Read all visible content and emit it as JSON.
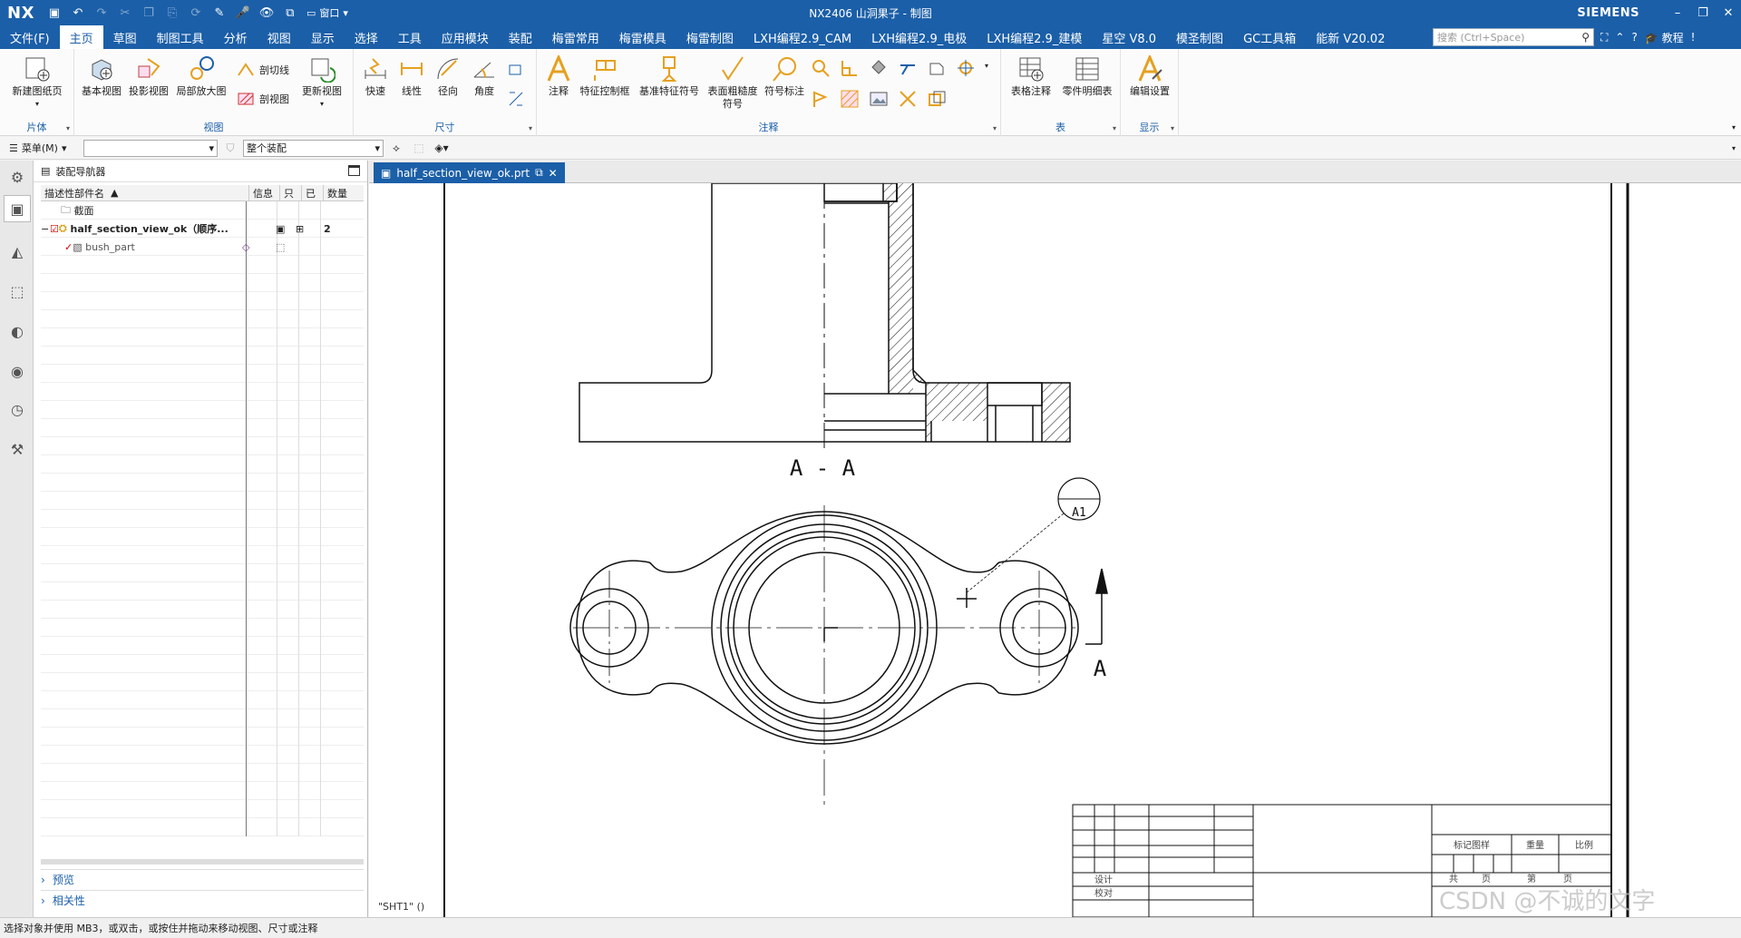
{
  "titlebar": {
    "logo": "NX",
    "window_title": "NX2406 山洞果子 - 制图",
    "brand": "SIEMENS",
    "menu_label": "窗口"
  },
  "menubar": {
    "items": [
      "文件(F)",
      "主页",
      "草图",
      "制图工具",
      "分析",
      "视图",
      "显示",
      "选择",
      "工具",
      "应用模块",
      "装配",
      "梅雷常用",
      "梅雷模具",
      "梅雷制图",
      "LXH编程2.9_CAM",
      "LXH编程2.9_电极",
      "LXH编程2.9_建模",
      "星空 V8.0",
      "模圣制图",
      "GC工具箱",
      "能新 V20.02"
    ],
    "active_index": 1,
    "search_placeholder": "搜索 (Ctrl+Space)",
    "tutorial": "教程"
  },
  "ribbon": {
    "groups": {
      "sheet": "片体",
      "view": "视图",
      "dimension": "尺寸",
      "annotation": "注释",
      "table": "表",
      "display": "显示"
    },
    "buttons": {
      "new_sheet": "新建图纸页",
      "base_view": "基本视图",
      "projected_view": "投影视图",
      "detail_view": "局部放大图",
      "section_line": "剖切线",
      "section_view": "剖视图",
      "update_view": "更新视图",
      "rapid": "快速",
      "linear": "线性",
      "radial": "径向",
      "angle": "角度",
      "note": "注释",
      "fcf": "特征控制框",
      "datum_symbol": "基准特征符号",
      "surface_finish": "表面粗糙度符号",
      "id_symbol": "符号标注",
      "tabular_note": "表格注释",
      "parts_list": "零件明细表",
      "edit_settings": "编辑设置"
    }
  },
  "cmdbar": {
    "menu": "菜单(M)",
    "filter_value": "",
    "scope_value": "整个装配"
  },
  "navigator": {
    "title": "装配导航器",
    "columns": [
      "描述性部件名",
      "信息",
      "只",
      "已",
      "数量"
    ],
    "rows": [
      {
        "name": "截面",
        "info": "",
        "qty": ""
      },
      {
        "name": "half_section_view_ok（顺序...",
        "info": "",
        "qty": "2"
      },
      {
        "name": "bush_part",
        "info": "",
        "qty": ""
      }
    ],
    "preview": "预览",
    "dependencies": "相关性"
  },
  "document": {
    "tab_label": "half_section_view_ok.prt",
    "sheet_label": "\"SHT1\" ()",
    "section_title": "A - A",
    "section_letter": "A",
    "balloon_text": "A1"
  },
  "title_block": {
    "labels": {
      "marking": "标记图样",
      "weight": "重量",
      "scale": "比例",
      "total": "共",
      "page": "页",
      "no": "第",
      "page2": "页",
      "design": "设计",
      "check": "校对"
    }
  },
  "watermark": "CSDN @不诚的文字",
  "statusbar": {
    "message": "选择对象并使用 MB3，或双击，或按住并拖动来移动视图、尺寸或注释"
  }
}
